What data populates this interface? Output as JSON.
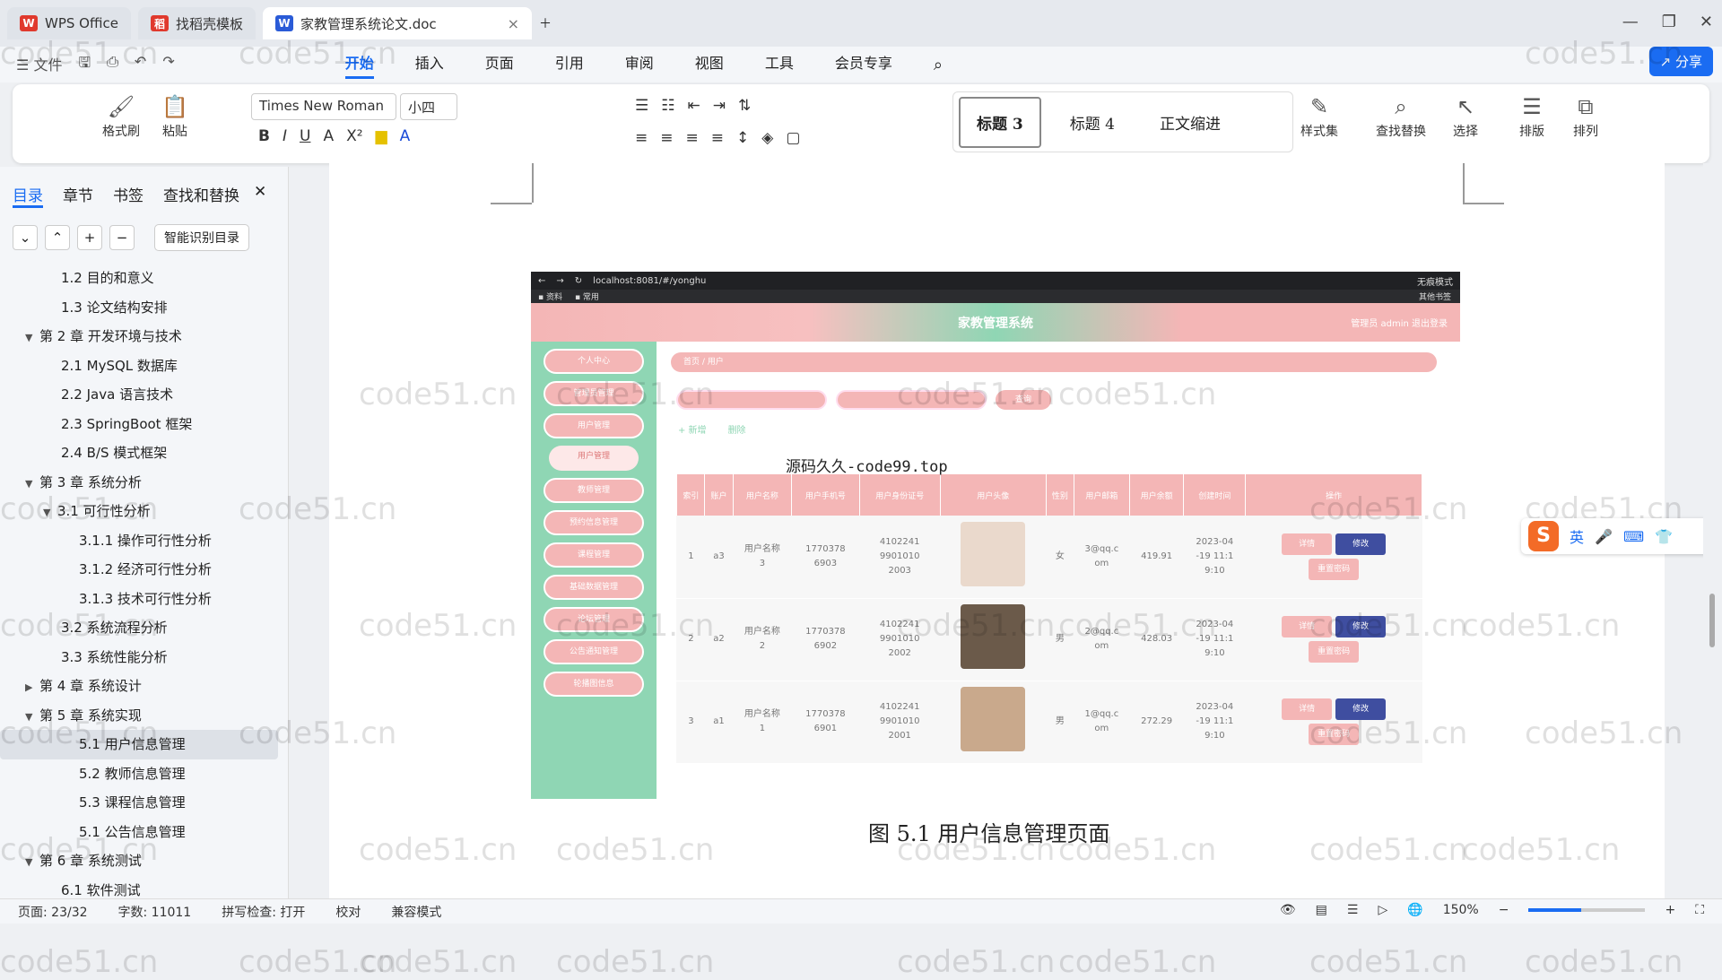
{
  "tabs": [
    {
      "label": "WPS Office",
      "logo": "W",
      "color": "#e0392d"
    },
    {
      "label": "找稻壳模板",
      "logo": "稻",
      "color": "#e0392d"
    },
    {
      "label": "家教管理系统论文.doc",
      "logo": "W",
      "color": "#2a5bd7"
    }
  ],
  "menu": {
    "file": "文件",
    "items": [
      "开始",
      "插入",
      "页面",
      "引用",
      "审阅",
      "视图",
      "工具",
      "会员专享"
    ],
    "active": "开始",
    "share": "分享"
  },
  "ribbon": {
    "format_painter": "格式刷",
    "paste": "粘贴",
    "font_name": "Times New Roman",
    "font_size": "小四",
    "style_sets": "样式集",
    "find_replace": "查找替换",
    "select": "选择",
    "layout": "排版",
    "arrange": "排列",
    "styles": [
      "标题 3",
      "标题 4",
      "正文缩进"
    ]
  },
  "panel": {
    "tabs": [
      "目录",
      "章节",
      "书签",
      "查找和替换"
    ],
    "smart_toc": "智能识别目录"
  },
  "toc": [
    {
      "label": "1.2 目的和意义",
      "level": 1
    },
    {
      "label": "1.3 论文结构安排",
      "level": 1
    },
    {
      "label": "第 2 章  开发环境与技术",
      "level": 0,
      "arrow": "▼"
    },
    {
      "label": "2.1 MySQL 数据库",
      "level": 1
    },
    {
      "label": "2.2 Java 语言技术",
      "level": 1
    },
    {
      "label": "2.3 SpringBoot 框架",
      "level": 1
    },
    {
      "label": "2.4 B/S 模式框架",
      "level": 1
    },
    {
      "label": "第 3 章  系统分析",
      "level": 0,
      "arrow": "▼"
    },
    {
      "label": "3.1 可行性分析",
      "level": 1,
      "arrow": "▼"
    },
    {
      "label": "3.1.1 操作可行性分析",
      "level": 2
    },
    {
      "label": "3.1.2 经济可行性分析",
      "level": 2
    },
    {
      "label": "3.1.3 技术可行性分析",
      "level": 2
    },
    {
      "label": "3.2 系统流程分析",
      "level": 1
    },
    {
      "label": "3.3 系统性能分析",
      "level": 1
    },
    {
      "label": "第 4 章  系统设计",
      "level": 0,
      "arrow": "▶"
    },
    {
      "label": "第 5 章  系统实现",
      "level": 0,
      "arrow": "▼"
    },
    {
      "label": "5.1 用户信息管理",
      "level": 2,
      "selected": true
    },
    {
      "label": "5.2  教师信息管理",
      "level": 2
    },
    {
      "label": "5.3 课程信息管理",
      "level": 2
    },
    {
      "label": "5.1 公告信息管理",
      "level": 2
    },
    {
      "label": "第 6 章  系统测试",
      "level": 0,
      "arrow": "▼"
    },
    {
      "label": "6.1 软件测试",
      "level": 1
    }
  ],
  "browser": {
    "url": "localhost:8081/#/yonghu",
    "bookmarks": [
      "资料",
      "常用"
    ],
    "other_bookmarks": "其他书签",
    "incognito": "无痕模式"
  },
  "app": {
    "title": "家教管理系统",
    "user": "管理员 admin",
    "logout": "退出登录",
    "crumb": "首页  /  用户",
    "search": "查询",
    "add": "+ 新增",
    "delete": "删除",
    "menu": [
      "个人中心",
      "管理员管理",
      "用户管理",
      "用户管理",
      "教师管理",
      "预约信息管理",
      "课程管理",
      "基础数据管理",
      "论坛管理",
      "公告通知管理",
      "轮播图信息"
    ],
    "headers": [
      "",
      "索引",
      "账户",
      "用户名称",
      "用户手机号",
      "用户身份证号",
      "用户头像",
      "性别",
      "用户邮箱",
      "用户余额",
      "创建时间",
      "操作"
    ],
    "rows": [
      {
        "idx": "1",
        "acc": "a3",
        "name": "用户名称\n3",
        "phone": "1770378\n6903",
        "id": "4102241\n9901010\n2003",
        "sex": "女",
        "email": "3@qq.c\nom",
        "bal": "419.91",
        "time": "2023-04\n-19 11:1\n9:10",
        "av": "#ead9cc"
      },
      {
        "idx": "2",
        "acc": "a2",
        "name": "用户名称\n2",
        "phone": "1770378\n6902",
        "id": "4102241\n9901010\n2002",
        "sex": "男",
        "email": "2@qq.c\nom",
        "bal": "428.03",
        "time": "2023-04\n-19 11:1\n9:10",
        "av": "#6b5a4a"
      },
      {
        "idx": "3",
        "acc": "a1",
        "name": "用户名称\n1",
        "phone": "1770378\n6901",
        "id": "4102241\n9901010\n2001",
        "sex": "男",
        "email": "1@qq.c\nom",
        "bal": "272.29",
        "time": "2023-04\n-19 11:1\n9:10",
        "av": "#c9a98c"
      }
    ],
    "btns": {
      "detail": "详情",
      "edit": "修改",
      "reset": "重置密码"
    }
  },
  "overlay_text": "源码久久-code99.top",
  "caption": "图 5.1  用户信息管理页面",
  "watermark": "code51.cn",
  "ime": {
    "lang": "英"
  },
  "status": {
    "page": "页面: 23/32",
    "words": "字数: 11011",
    "spell": "拼写检查: 打开",
    "proof": "校对",
    "compat": "兼容模式",
    "zoom": "150%",
    "zoom_level": 0.45
  }
}
